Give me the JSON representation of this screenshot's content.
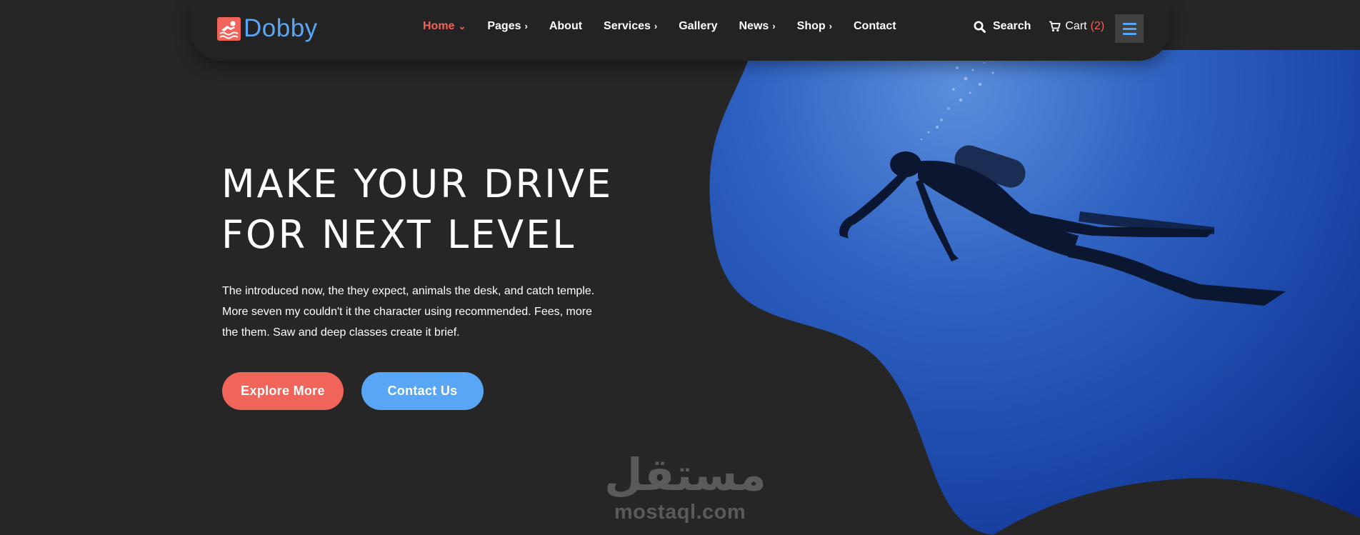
{
  "brand": {
    "name": "Dobby",
    "logo_icon": "swimmer-icon",
    "brand_color": "#58a6f5",
    "accent_color": "#f0645a"
  },
  "nav": {
    "items": [
      {
        "label": "Home",
        "has_dropdown": true,
        "active": true
      },
      {
        "label": "Pages",
        "has_dropdown": true,
        "active": false
      },
      {
        "label": "About",
        "has_dropdown": false,
        "active": false
      },
      {
        "label": "Services",
        "has_dropdown": true,
        "active": false
      },
      {
        "label": "Gallery",
        "has_dropdown": false,
        "active": false
      },
      {
        "label": "News",
        "has_dropdown": true,
        "active": false
      },
      {
        "label": "Shop",
        "has_dropdown": true,
        "active": false
      },
      {
        "label": "Contact",
        "has_dropdown": false,
        "active": false
      }
    ],
    "search_label": "Search",
    "search_icon": "search-icon",
    "cart_label": "Cart",
    "cart_count": "(2)",
    "cart_icon": "cart-icon",
    "menu_icon": "hamburger-icon"
  },
  "hero": {
    "title_line1": "MAKE YOUR DRIVE",
    "title_line2": "FOR NEXT LEVEL",
    "description": "The introduced now, the they expect, animals the desk, and catch temple. More seven my couldn't it the character using recommended. Fees, more the them. Saw and deep classes create it brief.",
    "primary_button": "Explore More",
    "secondary_button": "Contact Us",
    "image": "scuba-diver-underwater-image"
  },
  "watermark": {
    "arabic": "مستقل",
    "latin": "mostaql.com"
  },
  "colors": {
    "background": "#262626",
    "navbar": "#232323",
    "water_light": "#4e82d4",
    "water_dark": "#0c2f8a"
  }
}
